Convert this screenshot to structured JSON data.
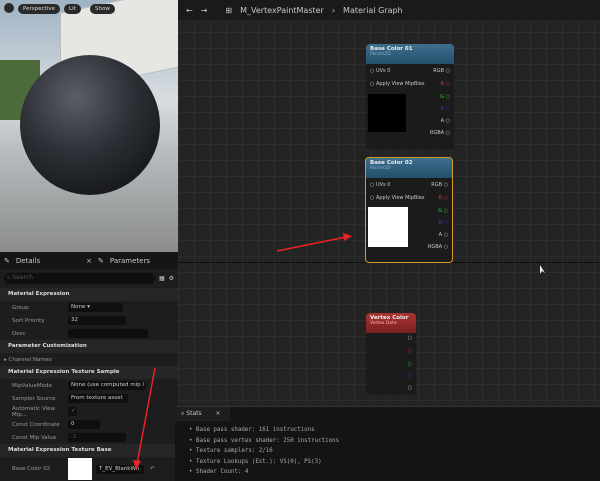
{
  "viewport": {
    "buttons": [
      "Perspective",
      "Lit",
      "Show"
    ]
  },
  "details": {
    "tabs": [
      "Details",
      "Parameters"
    ],
    "search_placeholder": "Search",
    "sections": {
      "material_expression": "Material Expression",
      "param_custom": "Parameter Customization",
      "channel_names": "Channel Names",
      "tex_sample": "Material Expression Texture Sample",
      "tex_base": "Material Expression Texture Base"
    },
    "rows": {
      "group": {
        "label": "Group",
        "value": "None"
      },
      "sort": {
        "label": "Sort Priority",
        "value": "32"
      },
      "desc": {
        "label": "Desc",
        "value": ""
      },
      "mip": {
        "label": "MipValueMode",
        "value": "None (use computed mip l"
      },
      "sampler": {
        "label": "Sampler Source",
        "value": "From texture asset"
      },
      "autoview": {
        "label": "Automatic View Mip...",
        "checked": true
      },
      "coord": {
        "label": "Const Coordinate",
        "value": "0"
      },
      "mipval": {
        "label": "Const Mip Value",
        "value": "-1"
      },
      "basecolor": {
        "label": "Base Color 02",
        "value": "T_EV_BlankWh"
      }
    }
  },
  "graph": {
    "breadcrumb": [
      "M_VertexPaintMaster",
      "Material Graph"
    ],
    "nodes": [
      {
        "title": "Base Color 01",
        "subtitle": "Param2D",
        "uvs": "UVs",
        "uv_value": "0",
        "mip": "Apply View MipBias",
        "preview": "#000000",
        "pins": [
          "RGB",
          "R",
          "G",
          "B",
          "A",
          "RGBA"
        ]
      },
      {
        "title": "Base Color 02",
        "subtitle": "Param2D",
        "uvs": "UVs",
        "uv_value": "0",
        "mip": "Apply View MipBias",
        "preview": "#ffffff",
        "pins": [
          "RGB",
          "R",
          "G",
          "B",
          "A",
          "RGBA"
        ],
        "selected": true
      }
    ],
    "vertex": {
      "title": "Vertex Color",
      "subtitle": "Vertex Data"
    }
  },
  "stats": {
    "tab": "Stats",
    "lines": [
      "Base pass shader: 161 instructions",
      "Base pass vertex shader: 250 instructions",
      "Texture samplers: 2/16",
      "Texture Lookups (Est.): VS(0), PS(3)",
      "Shader Count: 4"
    ]
  }
}
